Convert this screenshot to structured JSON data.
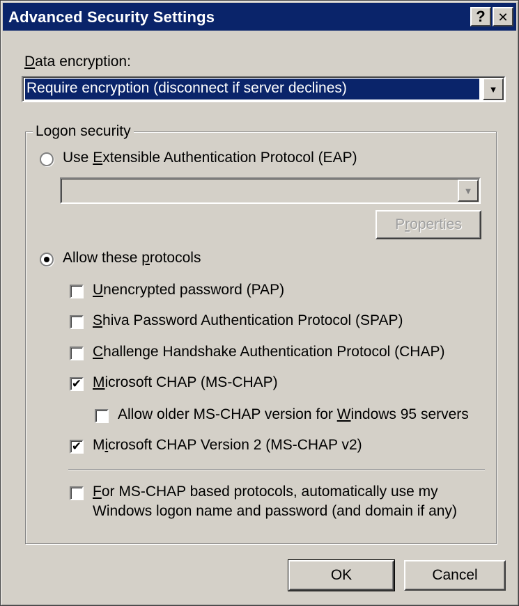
{
  "window": {
    "title": "Advanced Security Settings",
    "help_glyph": "?",
    "close_glyph": "✕"
  },
  "data_encryption": {
    "label_accel": "D",
    "label_rest": "ata encryption:",
    "selected": "Require encryption (disconnect if server declines)",
    "arrow": "▼"
  },
  "logon_security": {
    "title": "Logon security",
    "eap": {
      "pre": "Use ",
      "accel": "E",
      "post": "xtensible Authentication Protocol (EAP)",
      "selected": false,
      "combo_value": "",
      "arrow": "▼",
      "properties_accel": "r",
      "properties_pre": "P",
      "properties_post": "operties",
      "properties_enabled": false
    },
    "allow": {
      "pre": "Allow these ",
      "accel": "p",
      "post": "rotocols",
      "selected": true
    },
    "protocols": [
      {
        "accel": "U",
        "rest": "nencrypted password (PAP)",
        "checked": false
      },
      {
        "accel": "S",
        "rest": "hiva Password Authentication Protocol (SPAP)",
        "checked": false
      },
      {
        "accel": "C",
        "rest": "hallenge Handshake Authentication Protocol (CHAP)",
        "checked": false
      },
      {
        "accel": "M",
        "rest": "icrosoft CHAP (MS-CHAP)",
        "checked": true
      }
    ],
    "older_mschap": {
      "pre": "Allow older MS-CHAP version for ",
      "accel": "W",
      "post": "indows 95 servers",
      "checked": false
    },
    "mschap_v2": {
      "pre": "M",
      "accel": "i",
      "post": "crosoft CHAP Version 2 (MS-CHAP v2)",
      "checked": true
    },
    "auto_logon": {
      "accel": "F",
      "line1_rest": "or MS-CHAP based protocols, automatically use my",
      "line2": "Windows logon name and password (and domain if any)",
      "checked": false
    }
  },
  "buttons": {
    "ok": "OK",
    "cancel": "Cancel"
  },
  "check_glyph": "✔"
}
